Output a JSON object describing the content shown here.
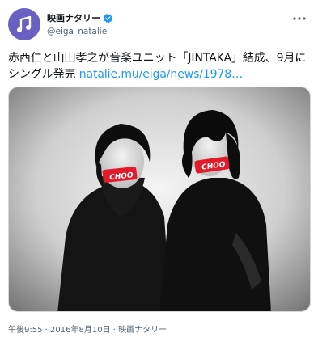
{
  "account": {
    "display_name": "映画ナタリー",
    "handle": "@eiga_natalie",
    "avatar_icon": "music-note-icon",
    "verified_icon": "verified-badge-icon",
    "more_icon": "more-options-icon"
  },
  "tweet": {
    "text": "赤西仁と山田孝之が音楽ユニット「JINTAKA」結成、9月にシングル発売 ",
    "link": "natalie.mu/eiga/news/1978…"
  },
  "media": {
    "mouth_tape_text_left": "CHOO",
    "mouth_tape_text_right": "CHOO"
  },
  "meta": {
    "time": "午後9:55",
    "separator": "·",
    "date": "2016年8月10日",
    "source": "映画ナタリー"
  },
  "colors": {
    "link": "#1d9bf0",
    "verified": "#1d9bf0",
    "avatar": "#6a5fc2",
    "tape": "#e21b2a"
  }
}
